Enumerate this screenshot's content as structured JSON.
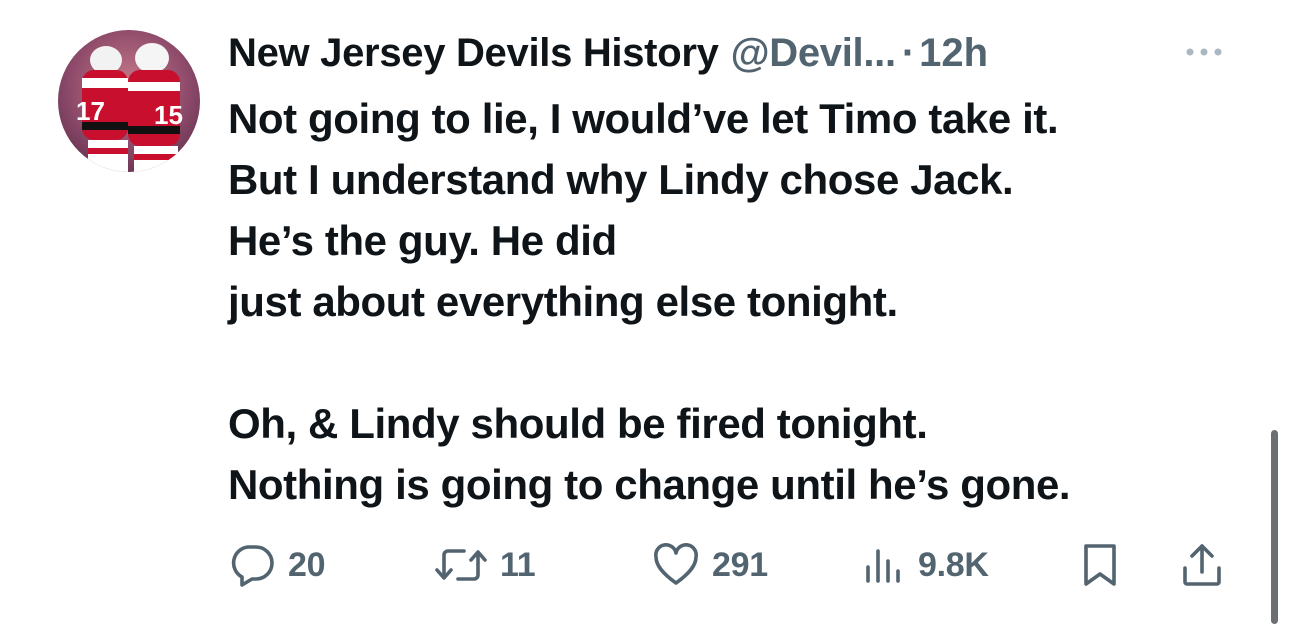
{
  "author": {
    "display_name": "New Jersey Devils History",
    "handle": "@Devil...",
    "separator": "·",
    "time": "12h",
    "avatar_icon": "hockey-players-avatar-icon"
  },
  "tweet": {
    "lines": [
      "Not going to lie, I would’ve let Timo take it.",
      "But I understand why Lindy chose Jack.",
      "He’s the guy. He did",
      "just about everything else tonight.",
      "",
      "Oh, & Lindy should be fired tonight.",
      "Nothing is going to change until he’s gone."
    ]
  },
  "actions": {
    "reply": {
      "icon": "reply-icon",
      "count": "20"
    },
    "retweet": {
      "icon": "retweet-icon",
      "count": "11"
    },
    "like": {
      "icon": "heart-icon",
      "count": "291"
    },
    "views": {
      "icon": "views-icon",
      "count": "9.8K"
    },
    "bookmark": {
      "icon": "bookmark-icon"
    },
    "share": {
      "icon": "share-icon"
    }
  },
  "colors": {
    "text_primary": "#0f1419",
    "text_secondary": "#536471",
    "devils_red": "#c8102e"
  }
}
